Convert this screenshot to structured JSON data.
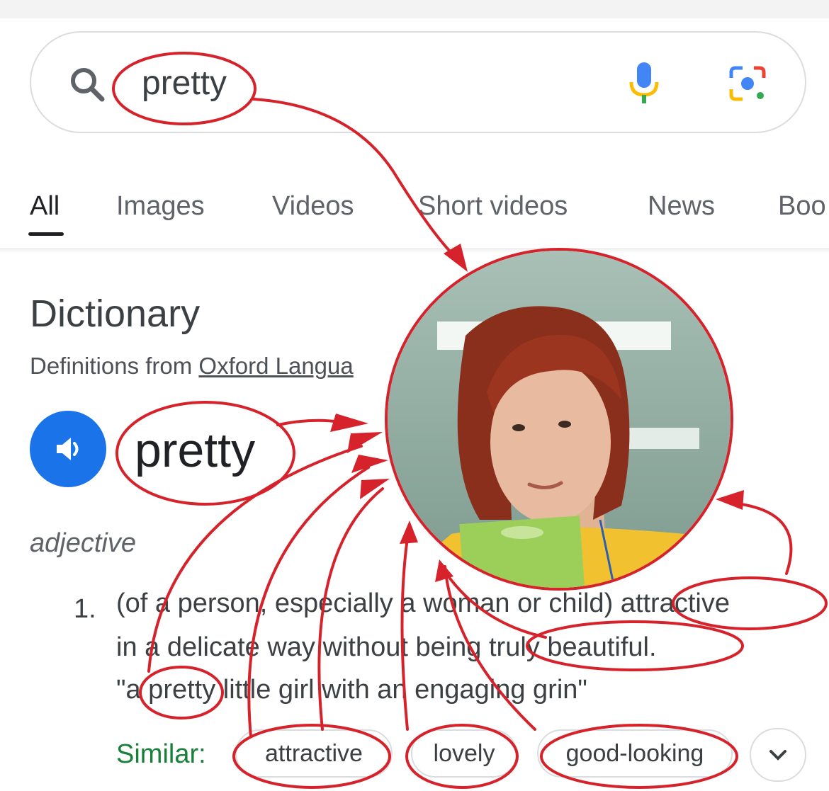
{
  "search": {
    "query": "pretty"
  },
  "tabs": [
    {
      "label": "All"
    },
    {
      "label": "Images"
    },
    {
      "label": "Videos"
    },
    {
      "label": "Short videos"
    },
    {
      "label": "News"
    },
    {
      "label": "Boo"
    }
  ],
  "dictionary": {
    "title": "Dictionary",
    "source_prefix": "Definitions from ",
    "source_link": "Oxford Langua",
    "headword": "pretty",
    "part_of_speech": "adjective",
    "definition_number": "1.",
    "definition_lines": [
      "(of a person, especially a woman or child) attractive",
      "in a delicate way without being truly beautiful.",
      "\"a pretty little girl with an engaging grin\""
    ],
    "similar_label": "Similar:",
    "similar": [
      "attractive",
      "lovely",
      "good-looking"
    ]
  },
  "colors": {
    "annotation_red": "#d5222b",
    "link_blue": "#1a73e8",
    "similar_green": "#188038"
  }
}
